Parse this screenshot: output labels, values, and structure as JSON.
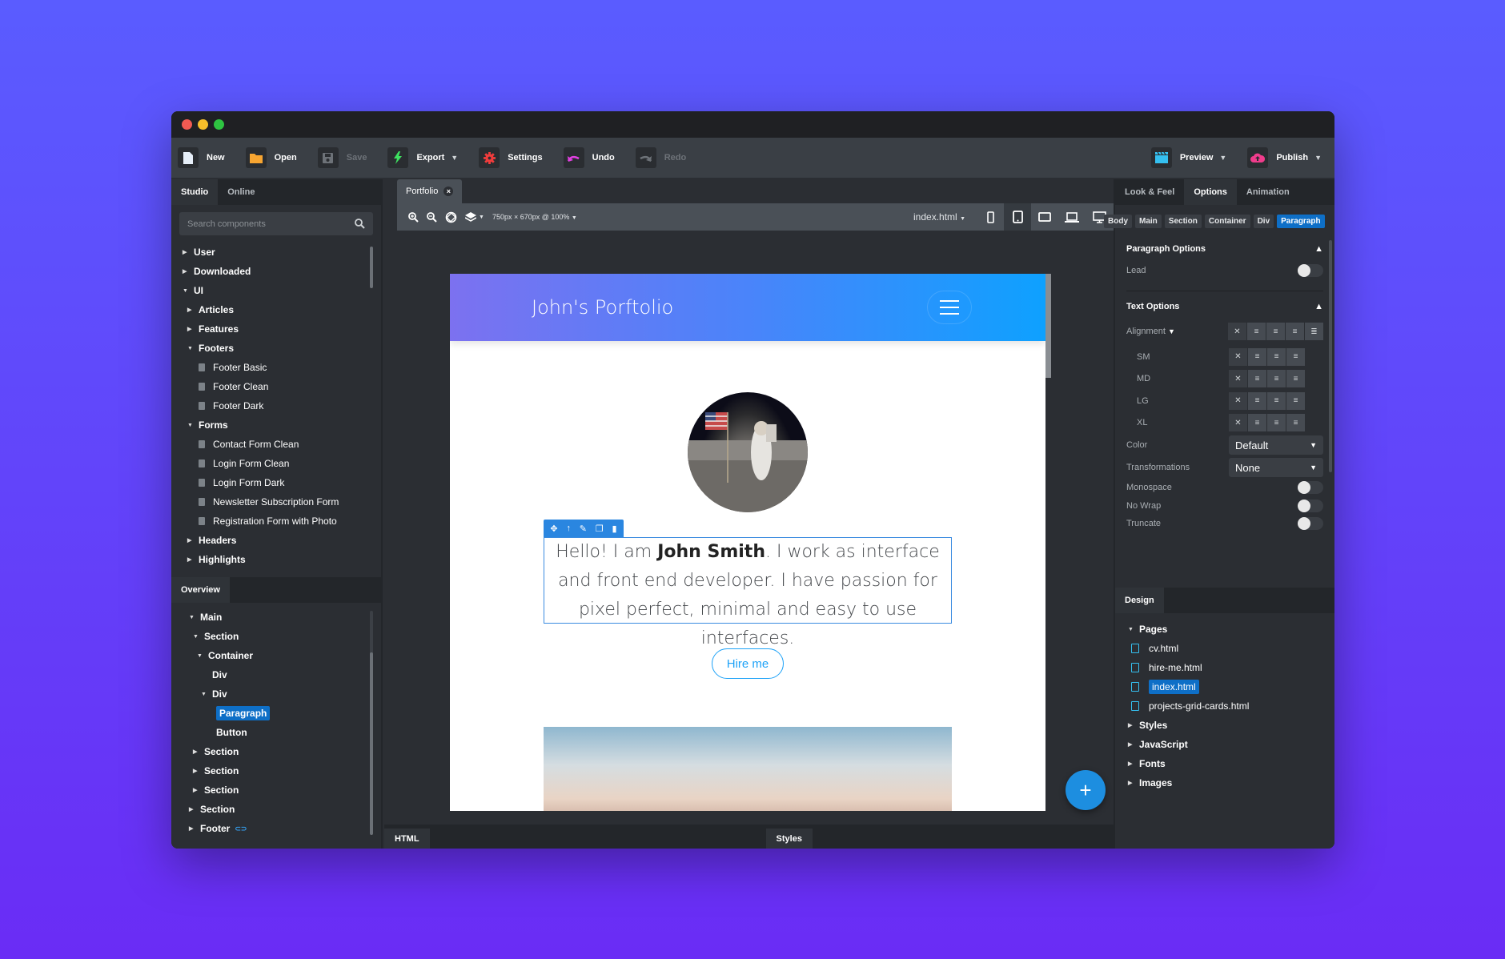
{
  "window": {
    "traffic_lights": [
      "#f25a52",
      "#f5be2a",
      "#2ec441"
    ]
  },
  "toolbar": {
    "left": [
      {
        "id": "new",
        "label": "New",
        "icon": "file-icon",
        "color": "#e6eef8",
        "disabled": false,
        "caret": false
      },
      {
        "id": "open",
        "label": "Open",
        "icon": "folder-icon",
        "color": "#f7a531",
        "disabled": false,
        "caret": false
      },
      {
        "id": "save",
        "label": "Save",
        "icon": "save-icon",
        "color": "#6d7278",
        "disabled": true,
        "caret": false
      },
      {
        "id": "export",
        "label": "Export",
        "icon": "lightning-icon",
        "color": "#3ee060",
        "disabled": false,
        "caret": true
      },
      {
        "id": "settings",
        "label": "Settings",
        "icon": "gear-icon",
        "color": "#f03c3c",
        "disabled": false,
        "caret": false
      },
      {
        "id": "undo",
        "label": "Undo",
        "icon": "undo-icon",
        "color": "#e040e0",
        "disabled": false,
        "caret": false
      },
      {
        "id": "redo",
        "label": "Redo",
        "icon": "redo-icon",
        "color": "#6d7278",
        "disabled": true,
        "caret": false
      }
    ],
    "right": [
      {
        "id": "preview",
        "label": "Preview",
        "icon": "clapperboard-icon",
        "color": "#35c0f0",
        "caret": true
      },
      {
        "id": "publish",
        "label": "Publish",
        "icon": "cloud-upload-icon",
        "color": "#f03c8c",
        "caret": true
      }
    ]
  },
  "left_panel": {
    "tabs": [
      "Studio",
      "Online"
    ],
    "active_tab": "Studio",
    "search_placeholder": "Search components",
    "tree": [
      {
        "label": "User",
        "level": 0,
        "type": "folder",
        "open": false
      },
      {
        "label": "Downloaded",
        "level": 0,
        "type": "folder",
        "open": false
      },
      {
        "label": "UI",
        "level": 0,
        "type": "folder",
        "open": true
      },
      {
        "label": "Articles",
        "level": 1,
        "type": "folder",
        "open": false
      },
      {
        "label": "Features",
        "level": 1,
        "type": "folder",
        "open": false
      },
      {
        "label": "Footers",
        "level": 1,
        "type": "folder",
        "open": true
      },
      {
        "label": "Footer Basic",
        "level": 2,
        "type": "file"
      },
      {
        "label": "Footer Clean",
        "level": 2,
        "type": "file"
      },
      {
        "label": "Footer Dark",
        "level": 2,
        "type": "file"
      },
      {
        "label": "Forms",
        "level": 1,
        "type": "folder",
        "open": true
      },
      {
        "label": "Contact Form Clean",
        "level": 2,
        "type": "file"
      },
      {
        "label": "Login Form Clean",
        "level": 2,
        "type": "file"
      },
      {
        "label": "Login Form Dark",
        "level": 2,
        "type": "file"
      },
      {
        "label": "Newsletter Subscription Form",
        "level": 2,
        "type": "file"
      },
      {
        "label": "Registration Form with Photo",
        "level": 2,
        "type": "file"
      },
      {
        "label": "Headers",
        "level": 1,
        "type": "folder",
        "open": false
      },
      {
        "label": "Highlights",
        "level": 1,
        "type": "folder",
        "open": false
      }
    ],
    "overview_tab": "Overview",
    "overview": [
      {
        "label": "Main",
        "level": 0,
        "twisty": "open"
      },
      {
        "label": "Section",
        "level": 1,
        "twisty": "open"
      },
      {
        "label": "Container",
        "level": 2,
        "twisty": "open"
      },
      {
        "label": "Div",
        "level": 3,
        "twisty": "none"
      },
      {
        "label": "Div",
        "level": 3,
        "twisty": "open"
      },
      {
        "label": "Paragraph",
        "level": 4,
        "twisty": "none",
        "selected": true
      },
      {
        "label": "Button",
        "level": 4,
        "twisty": "none"
      },
      {
        "label": "Section",
        "level": 1,
        "twisty": "closed"
      },
      {
        "label": "Section",
        "level": 1,
        "twisty": "closed"
      },
      {
        "label": "Section",
        "level": 1,
        "twisty": "closed"
      },
      {
        "label": "Section",
        "level": 0,
        "twisty": "closed"
      },
      {
        "label": "Footer",
        "level": 0,
        "twisty": "closed",
        "linked": true
      }
    ]
  },
  "center": {
    "doc_tab": "Portfolio",
    "viewport_label": "750px × 670px @ 100%",
    "page_select": "index.html",
    "devices": [
      "phone",
      "tablet",
      "tablet-landscape",
      "laptop",
      "desktop"
    ],
    "active_device": "tablet",
    "preview": {
      "brand": "John's Porftolio",
      "paragraph_pre": "Hello! I am ",
      "paragraph_bold": "John Smith",
      "paragraph_post": ". I work as interface and front end developer. I have passion for pixel perfect, minimal and easy to use interfaces.",
      "button": "Hire me"
    },
    "bottom_tabs": [
      "HTML",
      "Styles"
    ],
    "fab": "+"
  },
  "right_panel": {
    "tabs": [
      "Look & Feel",
      "Options",
      "Animation"
    ],
    "active_tab": "Options",
    "breadcrumbs": [
      "Body",
      "Main",
      "Section",
      "Container",
      "Div",
      "Paragraph"
    ],
    "active_crumb": "Paragraph",
    "paragraph_options": {
      "title": "Paragraph Options",
      "lead_label": "Lead",
      "lead": false
    },
    "text_options": {
      "title": "Text Options",
      "alignment_label": "Alignment",
      "breakpoints": [
        "SM",
        "MD",
        "LG",
        "XL"
      ],
      "color_label": "Color",
      "color_value": "Default",
      "transform_label": "Transformations",
      "transform_value": "None",
      "toggles": [
        {
          "label": "Monospace",
          "on": false
        },
        {
          "label": "No Wrap",
          "on": false
        },
        {
          "label": "Truncate",
          "on": false
        }
      ]
    },
    "design_tab": "Design",
    "design": {
      "pages_label": "Pages",
      "pages": [
        "cv.html",
        "hire-me.html",
        "index.html",
        "projects-grid-cards.html"
      ],
      "active_page": "index.html",
      "folders": [
        "Styles",
        "JavaScript",
        "Fonts",
        "Images"
      ]
    }
  }
}
